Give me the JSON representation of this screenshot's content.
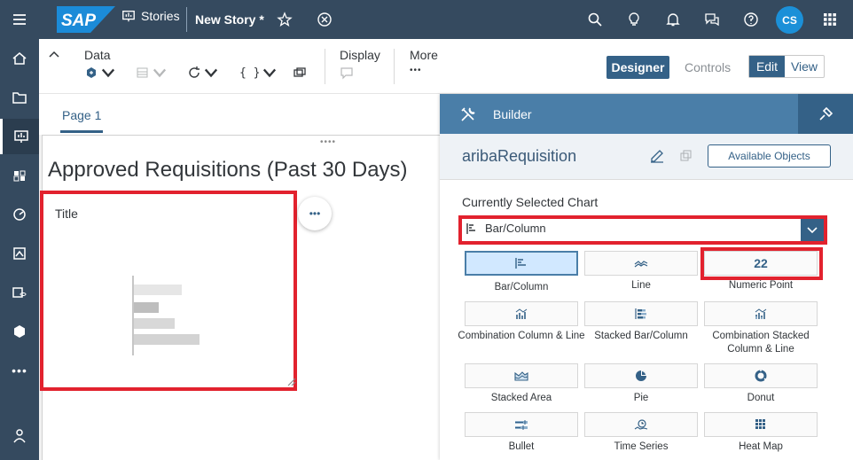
{
  "shell": {
    "stories_label": "Stories",
    "story_name": "New Story *",
    "avatar_initials": "CS",
    "logo_text": "SAP"
  },
  "toolbar": {
    "data_label": "Data",
    "display_label": "Display",
    "more_label": "More",
    "more_dots": "•••",
    "designer_label": "Designer",
    "controls_label": "Controls",
    "edit_label": "Edit",
    "view_label": "View",
    "braces": "{ }"
  },
  "page": {
    "tab_label": "Page 1",
    "heading": "Approved Requisitions (Past 30 Days)",
    "widget_title": "Title",
    "grip": "••••",
    "more_dots": "•••"
  },
  "builder": {
    "title": "Builder",
    "model_name": "aribaRequisition",
    "available_objects": "Available Objects",
    "currently_selected_label": "Currently Selected Chart",
    "selected_chart": "Bar/Column",
    "chart_types": [
      {
        "label": "Bar/Column",
        "icon": "bar-chart-icon",
        "selected": true
      },
      {
        "label": "Line",
        "icon": "line-chart-icon"
      },
      {
        "label": "Numeric Point",
        "icon": "numeric-point-icon",
        "glyph": "22"
      },
      {
        "label": "Combination Column & Line",
        "icon": "combination-chart-icon"
      },
      {
        "label": "Stacked Bar/Column",
        "icon": "stacked-bar-icon"
      },
      {
        "label": "Combination Stacked Column & Line",
        "icon": "combination-stacked-icon"
      },
      {
        "label": "Stacked Area",
        "icon": "area-chart-icon"
      },
      {
        "label": "Pie",
        "icon": "pie-chart-icon"
      },
      {
        "label": "Donut",
        "icon": "donut-chart-icon"
      },
      {
        "label": "Bullet",
        "icon": "bullet-chart-icon"
      },
      {
        "label": "Time Series",
        "icon": "time-series-icon"
      },
      {
        "label": "Heat Map",
        "icon": "heat-map-icon"
      }
    ]
  },
  "colors": {
    "shell": "#354a5f",
    "accent": "#346187",
    "builder_header": "#4a7ea8",
    "highlight": "#e2222e"
  }
}
